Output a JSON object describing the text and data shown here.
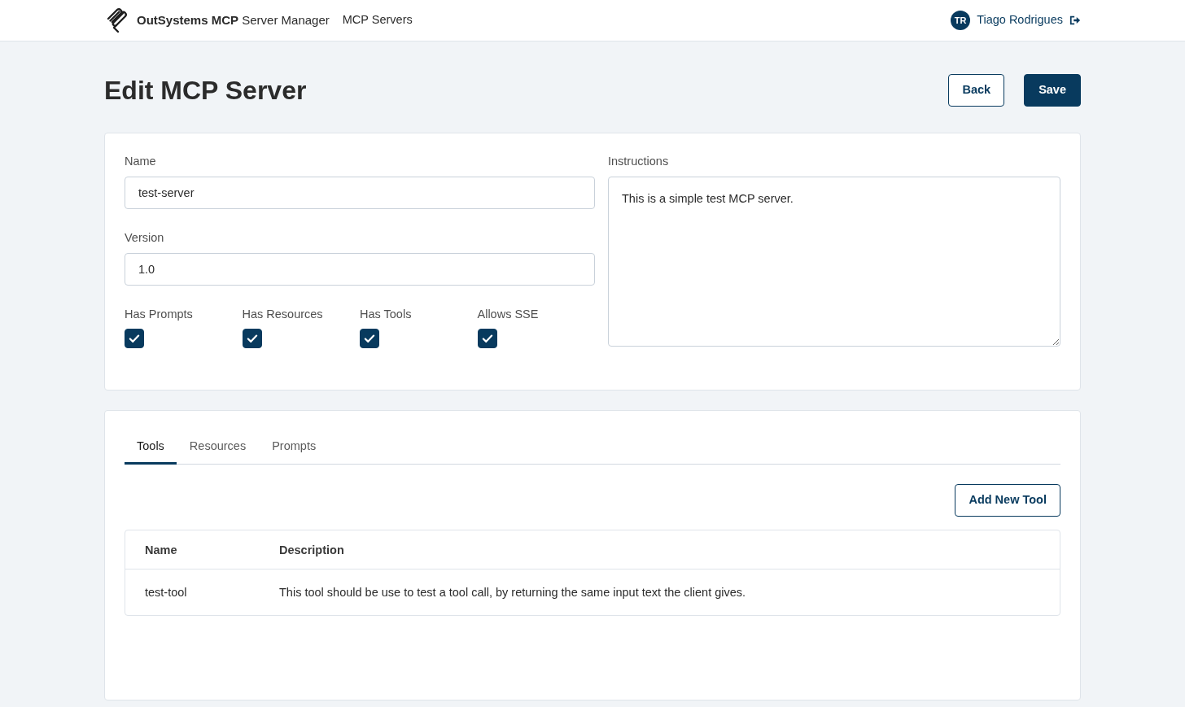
{
  "header": {
    "brand": "**OutSystems MCP** Server Manager",
    "nav": [
      {
        "label": "MCP Servers"
      }
    ],
    "user": {
      "initials": "TR",
      "name": "Tiago Rodrigues"
    }
  },
  "page": {
    "title": "Edit MCP Server",
    "buttons": [
      {
        "label": "Back",
        "kind": "secondary"
      },
      {
        "label": "Save",
        "kind": "primary"
      }
    ]
  },
  "form": {
    "fields": [
      {
        "label": "Name",
        "value": "test-server"
      },
      {
        "label": "Version",
        "value": "1.0"
      }
    ],
    "flags": [
      {
        "label": "Has Prompts",
        "checked": true
      },
      {
        "label": "Has Resources",
        "checked": true
      },
      {
        "label": "Has Tools",
        "checked": true
      },
      {
        "label": "Allows SSE",
        "checked": true
      }
    ],
    "instructions": {
      "label": "Instructions",
      "value": "This is a simple test MCP server."
    }
  },
  "tabs": [
    {
      "label": "Tools",
      "selected": true
    },
    {
      "label": "Resources",
      "selected": false
    },
    {
      "label": "Prompts",
      "selected": false
    }
  ],
  "tools_panel": {
    "add_button": "Add New Tool",
    "table": {
      "columns": [
        "Name",
        "Description"
      ],
      "rows": [
        [
          "test-tool",
          "This tool should be use to test a tool call, by returning the same input text the client gives."
        ]
      ]
    }
  }
}
